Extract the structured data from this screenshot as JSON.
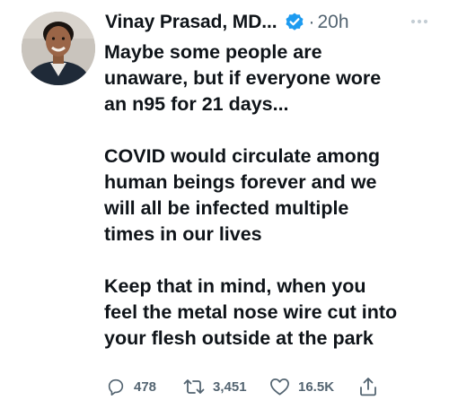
{
  "tweet": {
    "author_name": "Vinay Prasad, MD...",
    "verified_icon": "verified-badge-icon",
    "separator": "·",
    "time": "20h",
    "more_icon": "more-options-icon",
    "paragraphs": [
      "Maybe some people are\nunaware, but if everyone wore\nan n95 for 21 days...",
      "COVID would circulate among\nhuman beings forever and we\nwill all be infected multiple\ntimes in our lives",
      "Keep that in mind, when you\nfeel the metal nose wire cut into\nyour flesh outside at the park"
    ],
    "actions": {
      "reply_count": "478",
      "retweet_count": "3,451",
      "like_count": "16.5K",
      "reply_icon": "reply-icon",
      "retweet_icon": "retweet-icon",
      "like_icon": "like-icon",
      "share_icon": "share-icon"
    }
  },
  "colors": {
    "text_primary": "#0f1419",
    "text_secondary": "#536471",
    "verified_blue": "#1d9bf0"
  }
}
